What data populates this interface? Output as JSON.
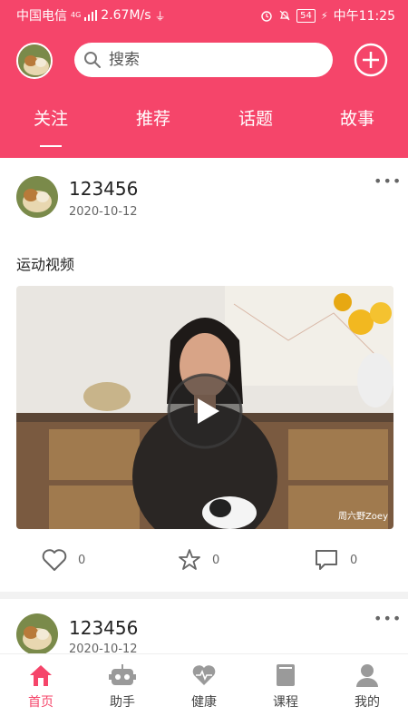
{
  "status_bar": {
    "carrier": "中国电信",
    "network": "4G",
    "speed": "2.67M/s",
    "battery": "54",
    "time": "中午11:25"
  },
  "header": {
    "search_placeholder": "搜索",
    "tabs": [
      {
        "label": "关注",
        "active": true
      },
      {
        "label": "推荐",
        "active": false
      },
      {
        "label": "话题",
        "active": false
      },
      {
        "label": "故事",
        "active": false
      }
    ],
    "colors": {
      "brand": "#f5456a",
      "text": "#ffffff"
    }
  },
  "posts": [
    {
      "username": "123456",
      "date": "2020-10-12",
      "text": "运动视频",
      "video_watermark": "周六野Zoey",
      "likes": "0",
      "favorites": "0",
      "comments": "0"
    },
    {
      "username": "123456",
      "date": "2020-10-12"
    }
  ],
  "bottom_nav": [
    {
      "label": "首页",
      "icon": "home-icon",
      "active": true
    },
    {
      "label": "助手",
      "icon": "robot-icon",
      "active": false
    },
    {
      "label": "健康",
      "icon": "heartbeat-icon",
      "active": false
    },
    {
      "label": "课程",
      "icon": "book-icon",
      "active": false
    },
    {
      "label": "我的",
      "icon": "user-icon",
      "active": false
    }
  ]
}
